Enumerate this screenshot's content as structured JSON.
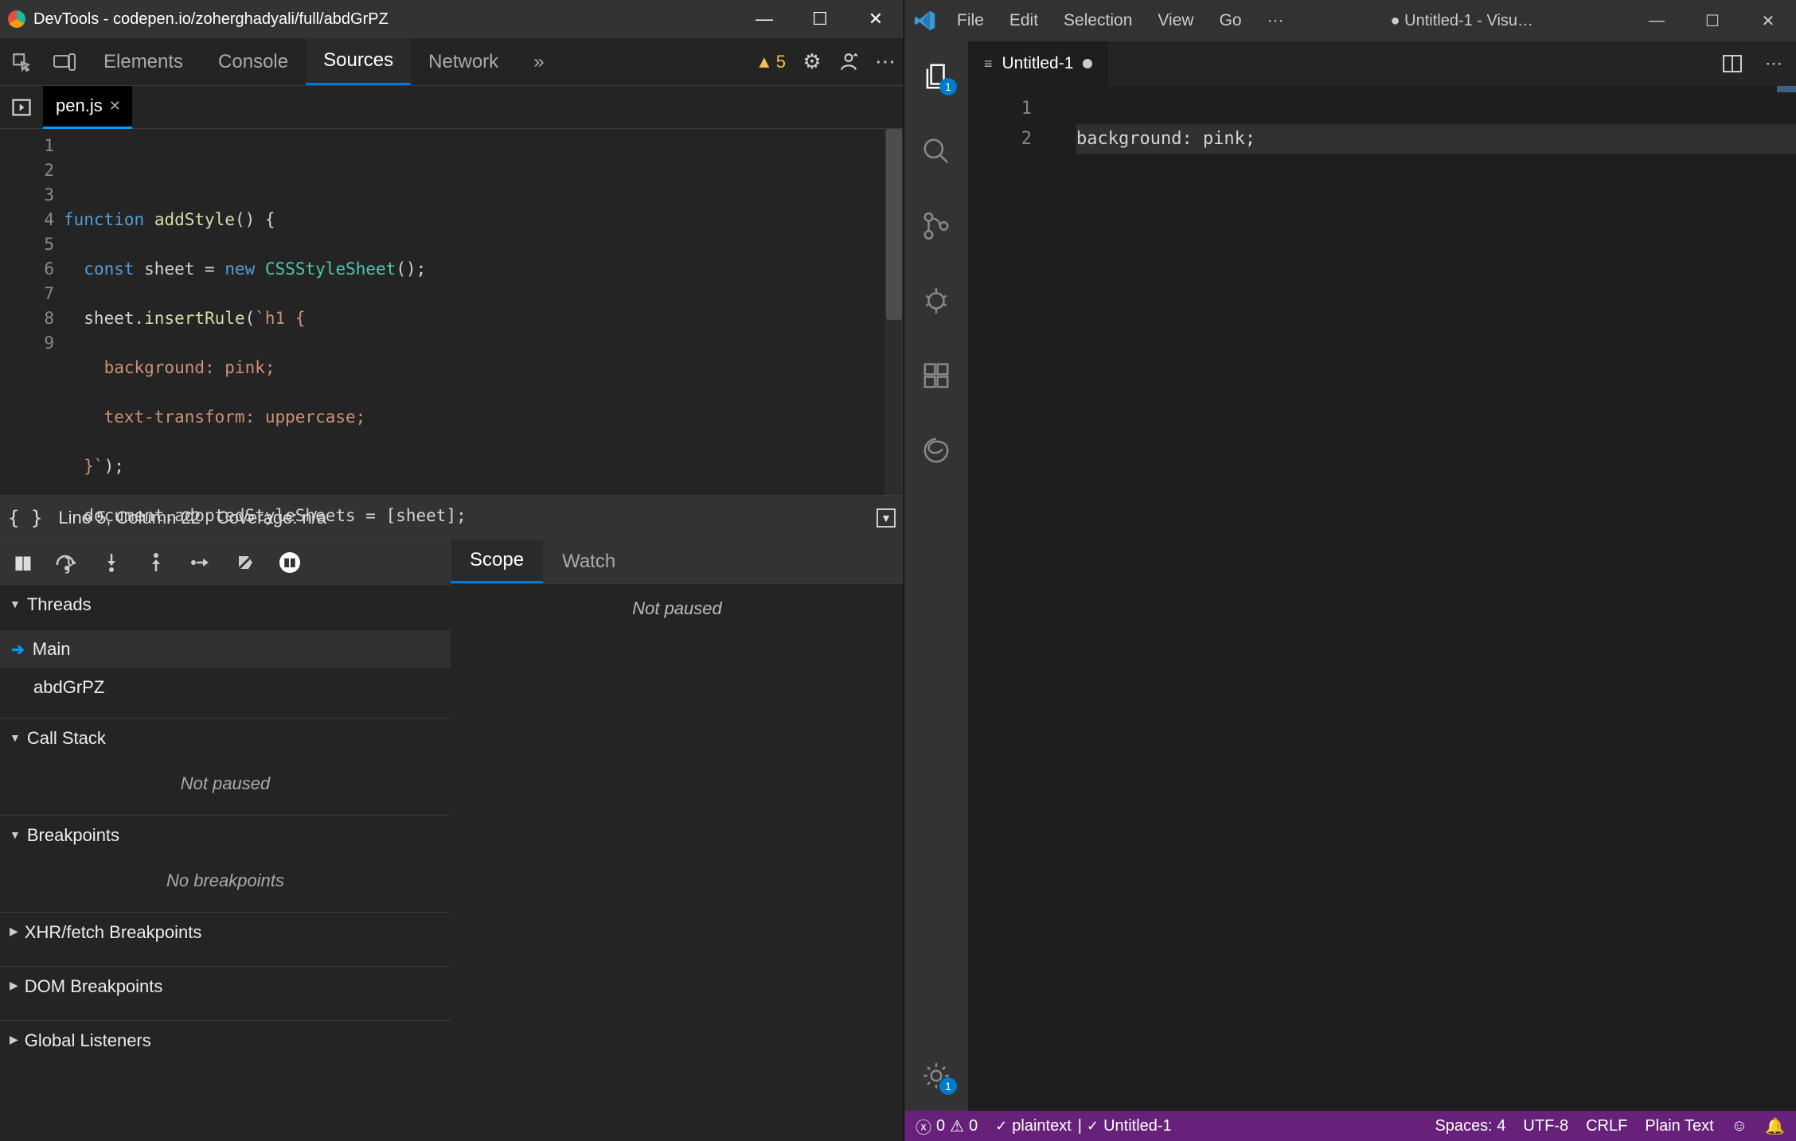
{
  "devtools": {
    "title": "DevTools - codepen.io/zoherghadyali/full/abdGrPZ",
    "tabs": [
      "Elements",
      "Console",
      "Sources",
      "Network"
    ],
    "active_tab": 2,
    "more_tabs_glyph": "»",
    "warnings_count": "5",
    "file_tab": "pen.js",
    "gutter_lines": [
      "1",
      "2",
      "3",
      "4",
      "5",
      "6",
      "7",
      "8",
      "9"
    ],
    "status": {
      "pos": "Line 5, Column 22",
      "coverage": "Coverage: n/a"
    },
    "scope_tabs": [
      "Scope",
      "Watch"
    ],
    "scope_msg": "Not paused",
    "threads": {
      "label": "Threads",
      "items": [
        "Main",
        "abdGrPZ"
      ]
    },
    "callstack": {
      "label": "Call Stack",
      "msg": "Not paused"
    },
    "breakpoints": {
      "label": "Breakpoints",
      "msg": "No breakpoints"
    },
    "xhr": {
      "label": "XHR/fetch Breakpoints"
    },
    "dom": {
      "label": "DOM Breakpoints"
    },
    "global": {
      "label": "Global Listeners"
    }
  },
  "vscode": {
    "menu": [
      "File",
      "Edit",
      "Selection",
      "View",
      "Go"
    ],
    "menu_more": "···",
    "window_title": "● Untitled-1 - Visu…",
    "activity_badges": {
      "explorer": "1",
      "settings": "1"
    },
    "editor_tab": "Untitled-1",
    "gutter": [
      "1",
      "2"
    ],
    "line1": "background: pink;",
    "status": {
      "errors": "0",
      "warnings": "0",
      "lang_detect": "plaintext",
      "file_note": "Untitled-1",
      "spaces": "Spaces: 4",
      "encoding": "UTF-8",
      "eol": "CRLF",
      "lang": "Plain Text"
    }
  }
}
